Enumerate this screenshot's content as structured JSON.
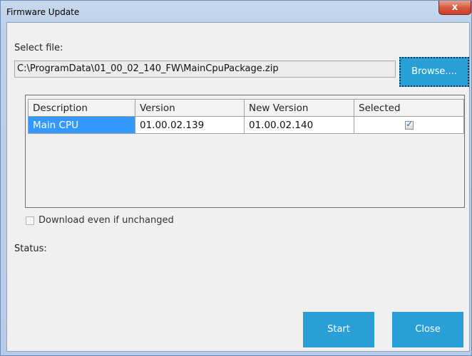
{
  "window": {
    "title": "Firmware Update",
    "close_glyph": "x"
  },
  "file": {
    "label": "Select file:",
    "path": "C:\\ProgramData\\01_00_02_140_FW\\MainCpuPackage.zip",
    "browse_label": "Browse...."
  },
  "grid": {
    "columns": [
      "Description",
      "Version",
      "New Version",
      "Selected"
    ],
    "rows": [
      {
        "description": "Main CPU",
        "version": "01.00.02.139",
        "new_version": "01.00.02.140",
        "selected": true
      }
    ]
  },
  "options": {
    "download_even_if_unchanged_label": "Download even if unchanged",
    "download_even_if_unchanged": false
  },
  "status": {
    "label": "Status:",
    "text": ""
  },
  "buttons": {
    "start_label": "Start",
    "close_label": "Close"
  },
  "colors": {
    "accent_button": "#2a9fd6",
    "selection": "#3399ff",
    "close_x": "#d6543b"
  },
  "icons": {
    "close": "close-icon",
    "checkbox": "checkbox-icon"
  }
}
